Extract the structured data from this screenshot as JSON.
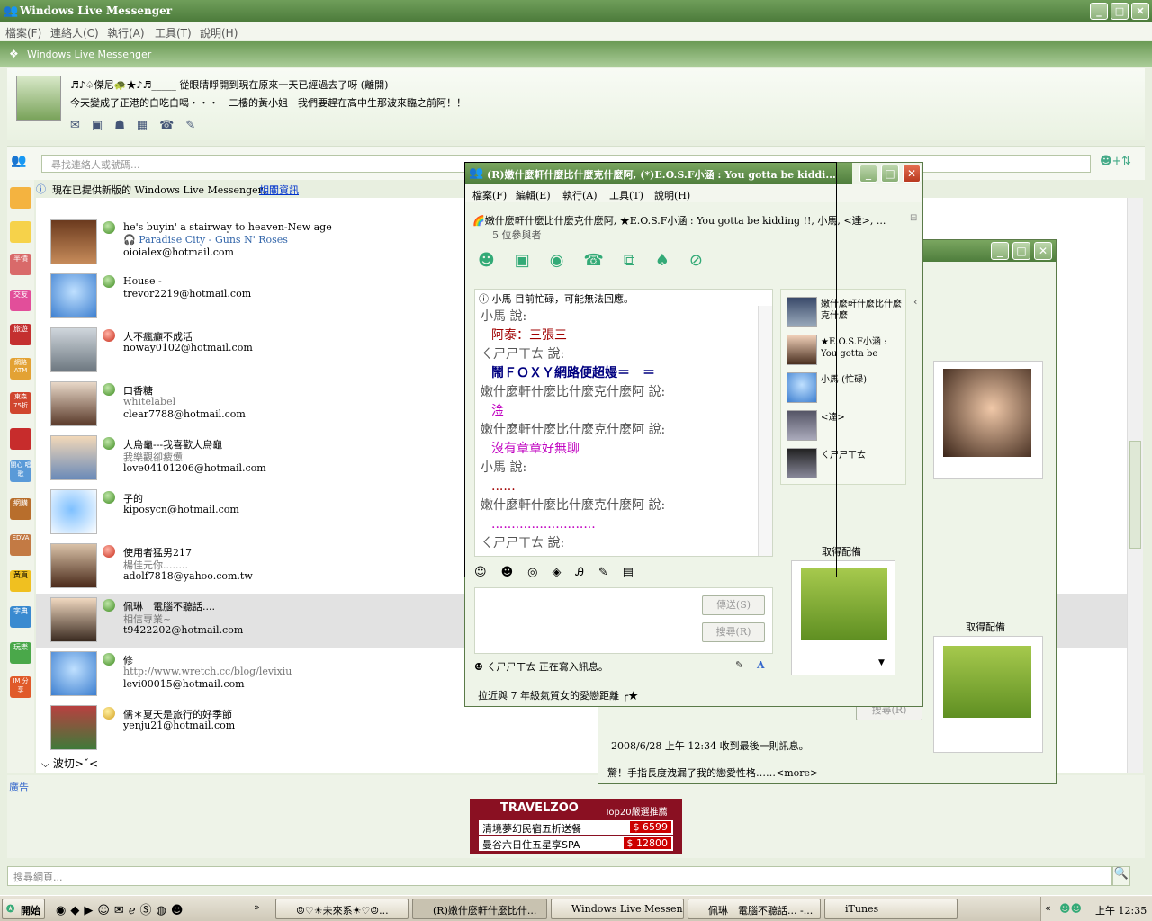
{
  "window": {
    "title": "Windows Live Messenger"
  },
  "menu": [
    "檔案(F)",
    "連絡人(C)",
    "執行(A)",
    "工具(T)",
    "說明(H)"
  ],
  "brand": "Windows Live Messenger",
  "profile": {
    "name": "♬♪♤傑尼🐢★♪♬_____ 從眼睛睜開到現在原來一天已經過去了呀 (離開)",
    "message": "今天變成了正港的白吃白喝・・・　二樓的黃小姐　我們要趕在高中生那波來臨之前阿！！"
  },
  "search": {
    "placeholder": "尋找連絡人或號碼..."
  },
  "notice": {
    "text": "現在已提供新版的 Windows Live Messenger。",
    "link": "相關資訊"
  },
  "sidebar_tiles": [
    "半價",
    "交友",
    "旅遊",
    "網路 ATM",
    "東森 75折",
    "開心 唱歌",
    "網購",
    "EDVA",
    "黃頁",
    "字典",
    "玩樂",
    "IM 分享"
  ],
  "contacts": [
    {
      "name": "he's buyin' a stairway to heaven-New age",
      "music": "Paradise City - Guns N' Roses",
      "email": "oioialex@hotmail.com",
      "status": "online"
    },
    {
      "name": "House -",
      "email": "trevor2219@hotmail.com",
      "status": "online"
    },
    {
      "name": "人不瘋癲不成活",
      "email": "noway0102@hotmail.com",
      "status": "busy"
    },
    {
      "name": "口香糖",
      "msg": "whitelabel",
      "email": "clear7788@hotmail.com",
      "status": "online"
    },
    {
      "name": "大烏龜---我喜歡大烏龜",
      "msg": "我樂觀卻疲憊",
      "email": "love04101206@hotmail.com",
      "status": "online"
    },
    {
      "name": "子的",
      "email": "kiposycn@hotmail.com",
      "status": "online"
    },
    {
      "name": "使用者猛男217",
      "msg": "楊佳元你........",
      "email": "adolf7818@yahoo.com.tw",
      "status": "busy"
    },
    {
      "name": "佩琳　電腦不聽話....",
      "msg": "相信專業~",
      "email": "t9422202@hotmail.com",
      "status": "online"
    },
    {
      "name": "修",
      "msg": "http://www.wretch.cc/blog/levixiu",
      "email": "levi00015@hotmail.com",
      "status": "online"
    },
    {
      "name": "儒＊夏天是旅行的好季節",
      "email": "yenju21@hotmail.com",
      "status": "away"
    }
  ],
  "group": "波切>ˇ<",
  "ad": {
    "label": "廣告",
    "brand": "TRAVELZOO",
    "sub": "Top20嚴選推薦",
    "line1": "清境夢幻民宿五折送餐",
    "price1": "$ 6599",
    "line2": "曼谷六日住五星享SPA",
    "price2": "$ 12800"
  },
  "bottom_search": {
    "placeholder": "搜尋網頁..."
  },
  "chat": {
    "title": "(R)嫩什麼軒什麼比什麼克什麼阿, (*)E.O.S.F小涵 : You gotta be kiddi...",
    "menu": [
      "檔案(F)",
      "編輯(E)",
      "執行(A)",
      "工具(T)",
      "說明(H)"
    ],
    "participants": "嫩什麼軒什麼比什麼克什麼阿, ★E.O.S.F小涵 : You gotta be kidding !!, 小馬, <達>, ...",
    "count": "5 位參與者",
    "info": "小馬 目前忙碌，可能無法回應。",
    "lines": [
      {
        "t": "小馬 說:",
        "c": "#555"
      },
      {
        "t": "阿泰：三張三",
        "c": "#a00000",
        "i": 1
      },
      {
        "t": "ㄑㄕㄕㄒㄊ 說:",
        "c": "#555"
      },
      {
        "t": "鬧ＦＯＸＹ網路便超嫚＝　＝",
        "c": "#000080",
        "i": 1,
        "b": 1
      },
      {
        "t": "嫩什麼軒什麼比什麼克什麼阿 說:",
        "c": "#555"
      },
      {
        "t": "淦",
        "c": "#c000c0",
        "i": 1
      },
      {
        "t": "嫩什麼軒什麼比什麼克什麼阿 說:",
        "c": "#555"
      },
      {
        "t": "沒有章章好無聊",
        "c": "#c000c0",
        "i": 1
      },
      {
        "t": "小馬 說:",
        "c": "#555"
      },
      {
        "t": "......",
        "c": "#a00000",
        "i": 1
      },
      {
        "t": "嫩什麼軒什麼比什麼克什麼阿 說:",
        "c": "#555"
      },
      {
        "t": "..........................",
        "c": "#c000c0",
        "i": 1
      },
      {
        "t": "ㄑㄕㄕㄒㄊ 說:",
        "c": "#555"
      }
    ],
    "side": [
      {
        "name": "嫩什麼軒什麼比什麼克什麼"
      },
      {
        "name": "★E.O.S.F小涵 : You gotta be"
      },
      {
        "name": "小馬 (忙碌)"
      },
      {
        "name": "<達>"
      },
      {
        "name": "ㄑㄕㄕㄒㄊ"
      }
    ],
    "get_pic": "取得配備",
    "send": "傳送(S)",
    "search_btn": "搜尋(R)",
    "typing": "ㄑㄕㄕㄒㄊ 正在寫入訊息。",
    "status": "拉近與 7 年級氣質女的愛戀距離 ╭★"
  },
  "back": {
    "get_pic": "取得配備",
    "last_msg": "2008/6/28 上午 12:34 收到最後一則訊息。",
    "status": "驚！手指長度洩漏了我的戀愛性格……<more>",
    "send": "搜尋(R)"
  },
  "taskbar": {
    "start": "開始",
    "items": [
      "☺♡☀未來系☀♡☺...",
      "(R)嫩什麼軒什麼比什...",
      "Windows Live Messenger",
      "佩琳　電腦不聽話... -...",
      "iTunes"
    ],
    "clock": "上午 12:35"
  }
}
